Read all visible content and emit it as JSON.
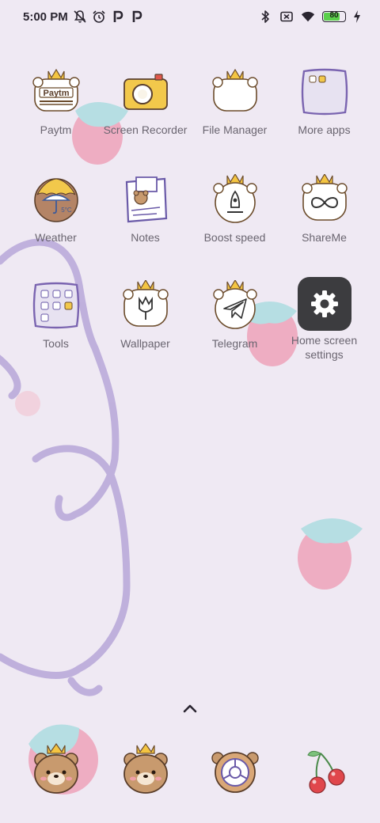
{
  "status_bar": {
    "time": "5:00 PM",
    "left_icons": [
      "mute-notifications-icon",
      "alarm-icon",
      "paytm-p-icon",
      "paytm-p-icon"
    ],
    "right_icons": [
      "bluetooth-icon",
      "no-sim-icon",
      "wifi-icon",
      "battery-icon",
      "charging-icon"
    ],
    "battery_level": "80",
    "battery_fraction": 0.8
  },
  "apps": [
    {
      "label": "Paytm",
      "icon": "paytm-bear-icon",
      "logo_text": "Paytm"
    },
    {
      "label": "Screen Recorder",
      "icon": "camera-icon"
    },
    {
      "label": "File Manager",
      "icon": "folder-bear-icon"
    },
    {
      "label": "More apps",
      "icon": "folder-icon"
    },
    {
      "label": "Weather",
      "icon": "umbrella-cookie-icon",
      "temp_text": "5°C"
    },
    {
      "label": "Notes",
      "icon": "notes-bear-icon"
    },
    {
      "label": "Boost speed",
      "icon": "rocket-icon"
    },
    {
      "label": "ShareMe",
      "icon": "infinity-icon"
    },
    {
      "label": "Tools",
      "icon": "tools-folder-icon"
    },
    {
      "label": "Wallpaper",
      "icon": "tulip-icon"
    },
    {
      "label": "Telegram",
      "icon": "telegram-icon"
    },
    {
      "label": "Home screen settings",
      "icon": "gear-icon"
    }
  ],
  "dock": [
    {
      "name": "dock-bear-app-1",
      "icon": "bear-crown-icon"
    },
    {
      "name": "dock-bear-app-2",
      "icon": "bear-crown-icon"
    },
    {
      "name": "dock-browser",
      "icon": "chrome-cookie-icon"
    },
    {
      "name": "dock-cherry-app",
      "icon": "cherry-icon"
    }
  ],
  "colors": {
    "background": "#efe9f3",
    "label": "#6a6570",
    "lilac_stroke": "#b0a0d0",
    "strawberry": "#e98aa8",
    "leaf": "#9fd6dc",
    "settings_tile": "#3c3c3f"
  }
}
